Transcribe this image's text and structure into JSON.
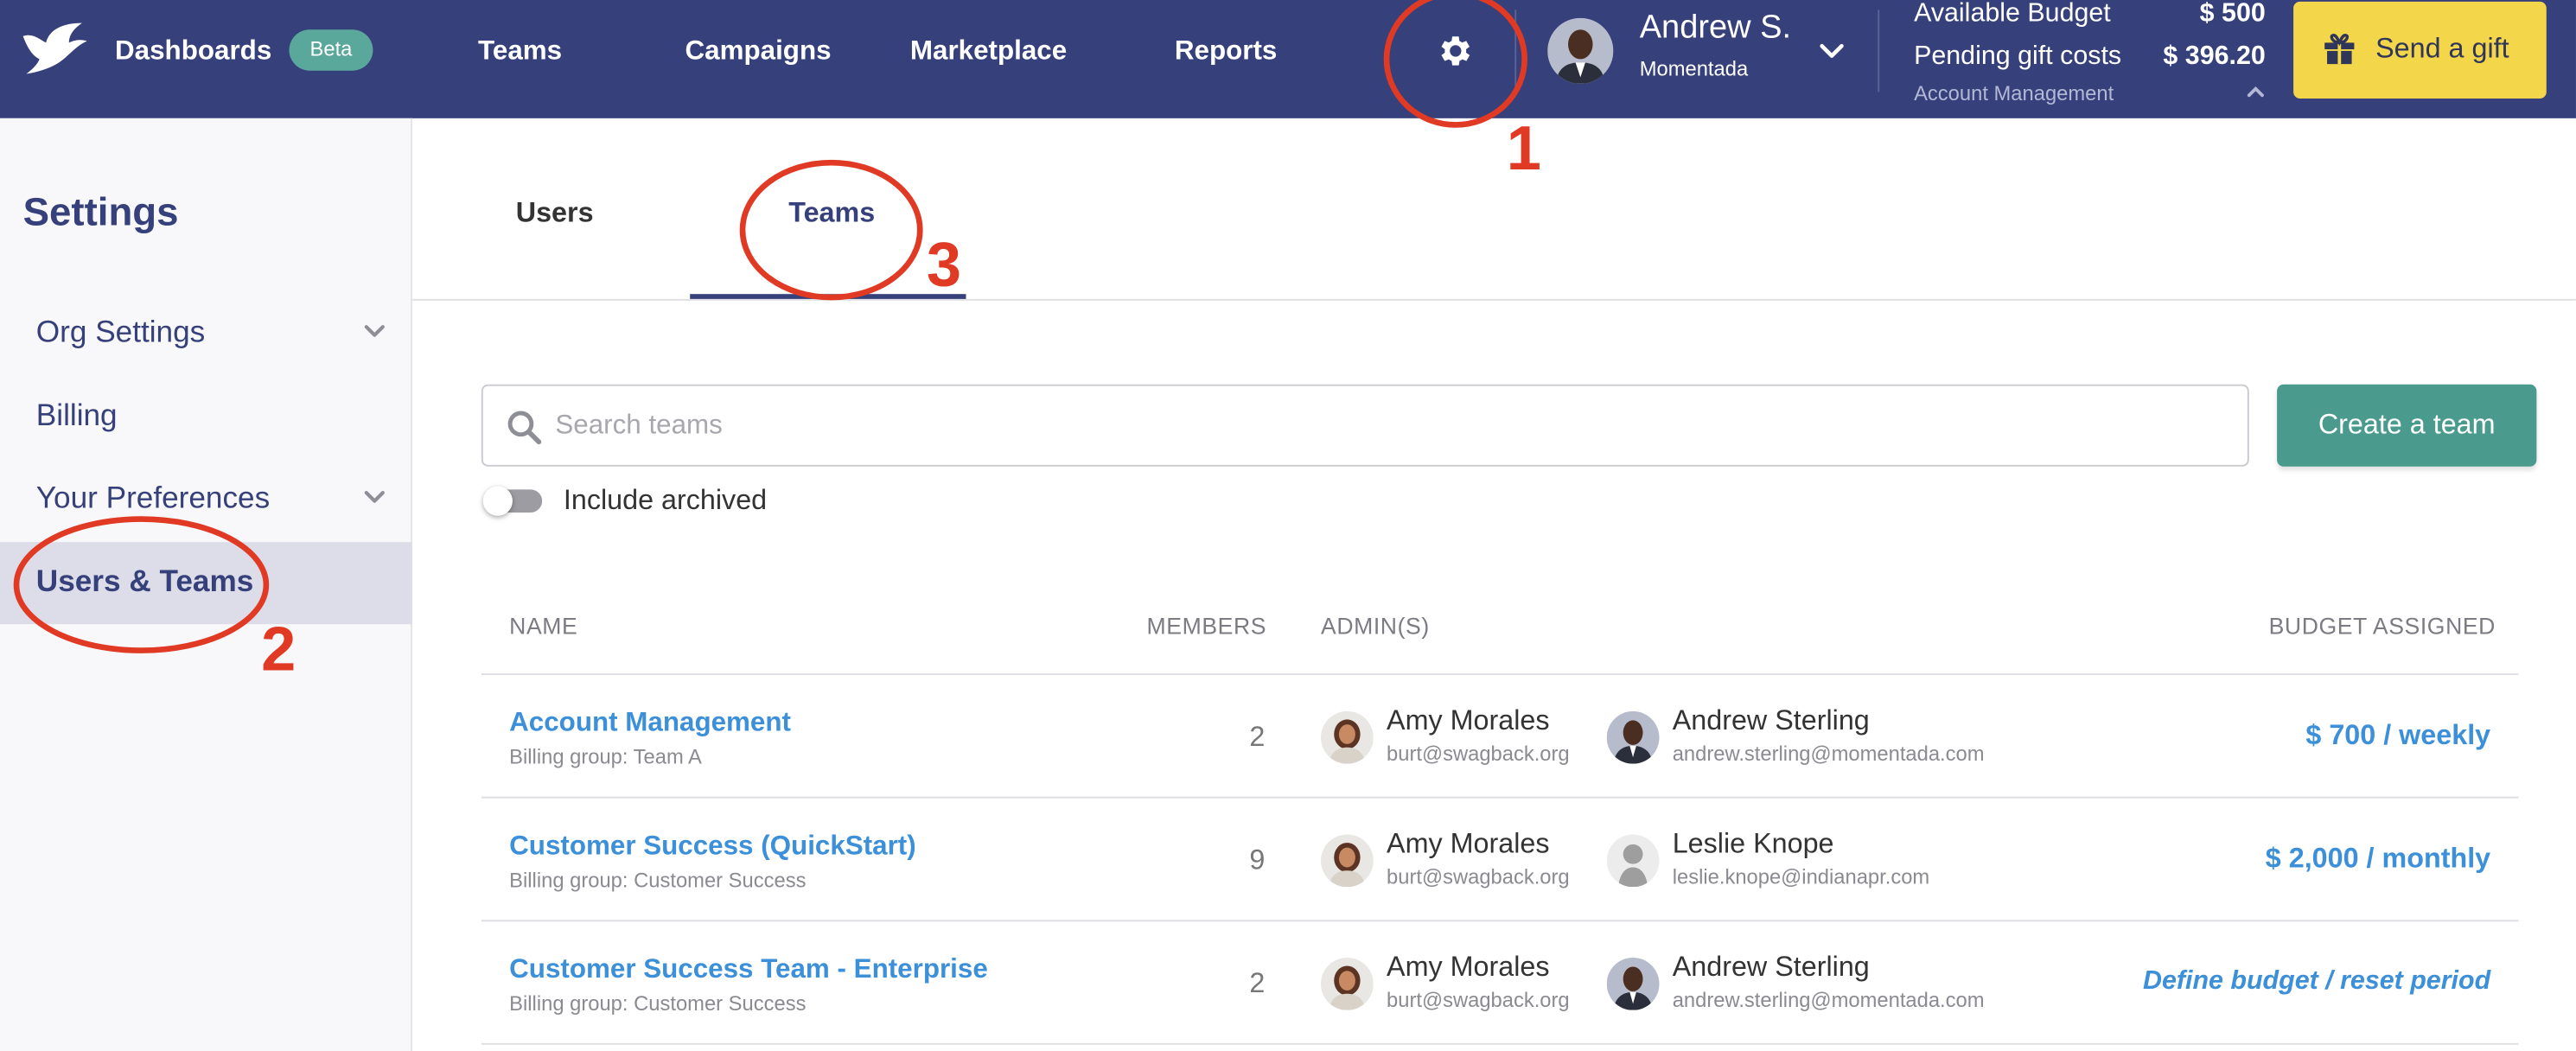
{
  "header": {
    "nav": {
      "dashboards": "Dashboards",
      "beta": "Beta",
      "teams": "Teams",
      "campaigns": "Campaigns",
      "marketplace": "Marketplace",
      "reports": "Reports"
    },
    "user": {
      "name": "Andrew S.",
      "org": "Momentada"
    },
    "budget": {
      "available_label": "Available Budget",
      "available_value": "$ 500",
      "pending_label": "Pending gift costs",
      "pending_value": "$ 396.20",
      "team": "Account Management"
    },
    "send_gift": "Send a gift"
  },
  "sidebar": {
    "title": "Settings",
    "items": [
      {
        "label": "Org Settings",
        "has_chevron": true
      },
      {
        "label": "Billing",
        "has_chevron": false
      },
      {
        "label": "Your Preferences",
        "has_chevron": true
      },
      {
        "label": "Users & Teams",
        "active": true
      }
    ]
  },
  "tabs": [
    {
      "label": "Users",
      "active": false
    },
    {
      "label": "Teams",
      "active": true
    }
  ],
  "search": {
    "placeholder": "Search teams",
    "value": ""
  },
  "create_button": "Create a team",
  "include_archived": {
    "label": "Include archived",
    "on": false
  },
  "table": {
    "headers": {
      "name": "NAME",
      "members": "MEMBERS",
      "admins": "ADMIN(S)",
      "budget": "BUDGET ASSIGNED"
    },
    "rows": [
      {
        "name": "Account Management",
        "billing": "Billing group: Team A",
        "members": "2",
        "admins": [
          {
            "name": "Amy Morales",
            "email": "burt@swagback.org"
          },
          {
            "name": "Andrew Sterling",
            "email": "andrew.sterling@momentada.com"
          }
        ],
        "budget": "$ 700 / weekly"
      },
      {
        "name": "Customer Success (QuickStart)",
        "billing": "Billing group: Customer Success",
        "members": "9",
        "admins": [
          {
            "name": "Amy Morales",
            "email": "burt@swagback.org"
          },
          {
            "name": "Leslie Knope",
            "email": "leslie.knope@indianapr.com"
          }
        ],
        "budget": "$ 2,000 / monthly"
      },
      {
        "name": "Customer Success Team - Enterprise",
        "billing": "Billing group: Customer Success",
        "members": "2",
        "admins": [
          {
            "name": "Amy Morales",
            "email": "burt@swagback.org"
          },
          {
            "name": "Andrew Sterling",
            "email": "andrew.sterling@momentada.com"
          }
        ],
        "budget": "Define budget / reset period"
      }
    ]
  },
  "annotations": {
    "one": "1",
    "two": "2",
    "three": "3"
  },
  "colors": {
    "header_bg": "#36407a",
    "accent_teal": "#4a9b8e",
    "gift_yellow": "#f3d64a",
    "link_blue": "#3c8fd9",
    "annotation_red": "#e03a24"
  }
}
